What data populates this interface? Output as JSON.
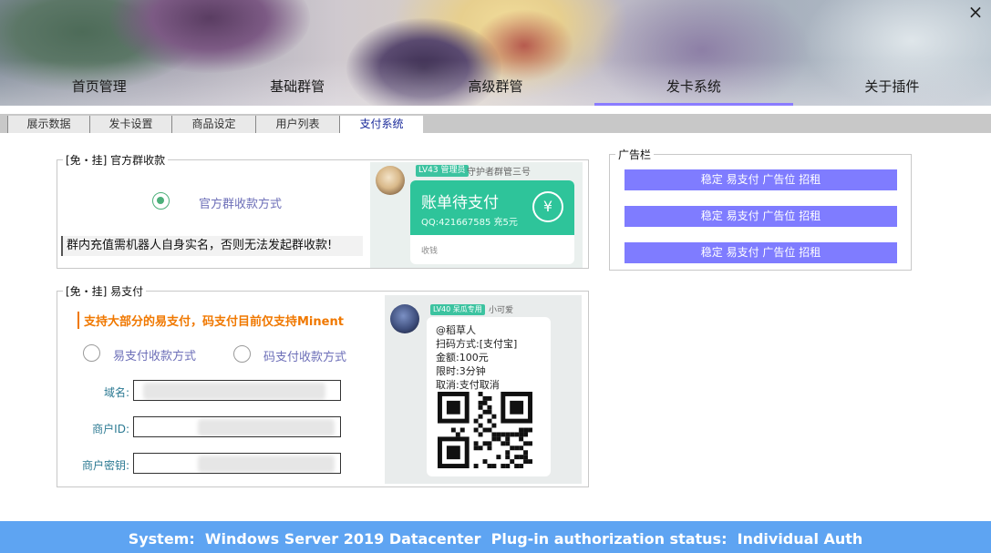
{
  "window": {
    "close_glyph": "×"
  },
  "main_nav": {
    "items": [
      {
        "label": "首页管理"
      },
      {
        "label": "基础群管"
      },
      {
        "label": "高级群管"
      },
      {
        "label": "发卡系统"
      },
      {
        "label": "关于插件"
      }
    ],
    "active_index": 3,
    "accent_color": "#8a7cff"
  },
  "sub_tabs": {
    "items": [
      {
        "label": "展示数据"
      },
      {
        "label": "发卡设置"
      },
      {
        "label": "商品设定"
      },
      {
        "label": "用户列表"
      },
      {
        "label": "支付系统"
      }
    ],
    "active_index": 4
  },
  "official_group": {
    "title": "[免・挂] 官方群收款",
    "radio_label": "官方群收款方式",
    "radio_checked": true,
    "notice": "群内充值需机器人自身实名，否则无法发起群收款!",
    "preview": {
      "level_badge": "LV43 管理员",
      "sender": "守护者群管三号",
      "card_title": "账单待支付",
      "card_sub": "QQ:421667585 充5元",
      "currency_symbol": "¥",
      "footer": "收钱"
    }
  },
  "epay": {
    "title": "[免・挂] 易支付",
    "notice": "支持大部分的易支付，码支付目前仅支持Minent",
    "options": [
      {
        "label": "易支付收款方式",
        "checked": false
      },
      {
        "label": "码支付收款方式",
        "checked": false
      }
    ],
    "fields": [
      {
        "label": "域名:",
        "value": ""
      },
      {
        "label": "商户ID:",
        "value": ""
      },
      {
        "label": "商户密钥:",
        "value": ""
      }
    ],
    "preview": {
      "level_badge": "LV40 呆瓜专用",
      "sender": "小可爱",
      "lines": [
        "@稻草人",
        "扫码方式:[支付宝]",
        "金额:100元",
        "限时:3分钟",
        "取消:支付取消"
      ]
    }
  },
  "ads": {
    "title": "广告栏",
    "buttons": [
      {
        "label": "稳定 易支付 广告位 招租"
      },
      {
        "label": "稳定 易支付 广告位 招租"
      },
      {
        "label": "稳定 易支付 广告位 招租"
      }
    ],
    "button_color": "#7f7cff"
  },
  "status_bar": {
    "text": "System:  Windows Server 2019 Datacenter  Plug-in authorization status:  Individual Auth",
    "color": "#5ea4f2"
  }
}
